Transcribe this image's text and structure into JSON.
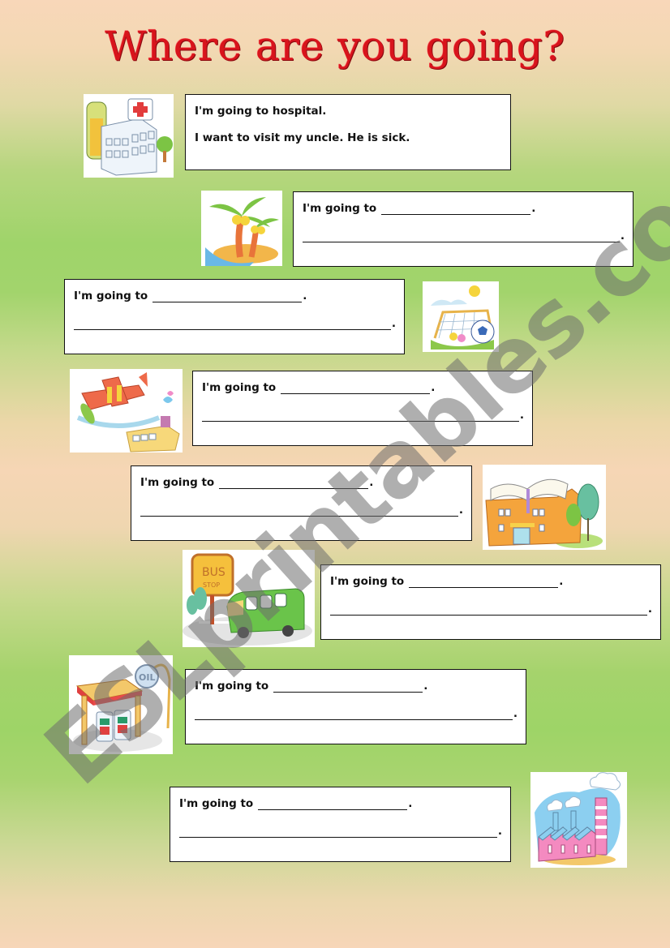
{
  "title": "Where are you going?",
  "watermark": "ESLprintables.com",
  "example": {
    "line1": "I'm going to hospital.",
    "line2": "I want to visit my uncle. He is sick.",
    "icon": "hospital-icon"
  },
  "exercises": [
    {
      "prompt": "I'm going to",
      "period": ".",
      "icon": "beach-island-icon"
    },
    {
      "prompt": "I'm going to",
      "period": ".",
      "icon": "soccer-field-icon"
    },
    {
      "prompt": "I'm going to",
      "period": ".",
      "icon": "airport-icon"
    },
    {
      "prompt": "I'm going to",
      "period": ".",
      "icon": "library-icon"
    },
    {
      "prompt": "I'm going to",
      "period": ".",
      "icon": "bus-stop-icon"
    },
    {
      "prompt": "I'm going to",
      "period": ".",
      "icon": "gas-station-icon"
    },
    {
      "prompt": "I'm going to",
      "period": ".",
      "icon": "factory-icon"
    }
  ],
  "colors": {
    "title": "#d8141c",
    "box_border": "#111111",
    "background_peach": "#f8d7b9",
    "background_green": "#9fd46a"
  }
}
